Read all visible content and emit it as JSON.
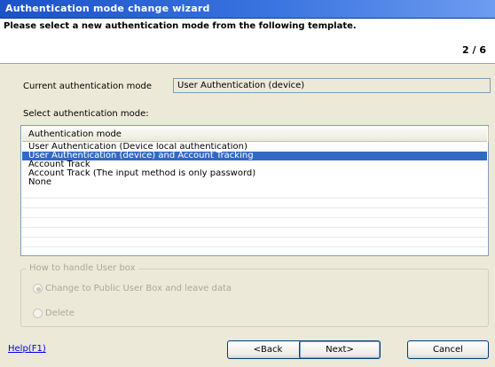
{
  "window": {
    "title": "Authentication mode change wizard"
  },
  "header": {
    "instruction": "Please select a new authentication mode from the following template.",
    "step": "2 / 6"
  },
  "current_mode": {
    "label": "Current authentication mode",
    "value": "User Authentication (device)"
  },
  "select_mode": {
    "label": "Select authentication mode:",
    "column_header": "Authentication mode",
    "options": [
      "User Authentication (Device local authentication)",
      "User Authentication (device) and Account Tracking",
      "Account Track",
      "Account Track (The input method is only password)",
      "None"
    ],
    "selected_index": 1
  },
  "user_box": {
    "legend": "How to handle User box",
    "option_change": "Change to Public User Box and leave data",
    "option_delete": "Delete",
    "selected": "change",
    "enabled": false
  },
  "footer": {
    "help_link": "Help(F1)",
    "back_label": "<Back",
    "next_label": "Next>",
    "cancel_label": "Cancel"
  }
}
